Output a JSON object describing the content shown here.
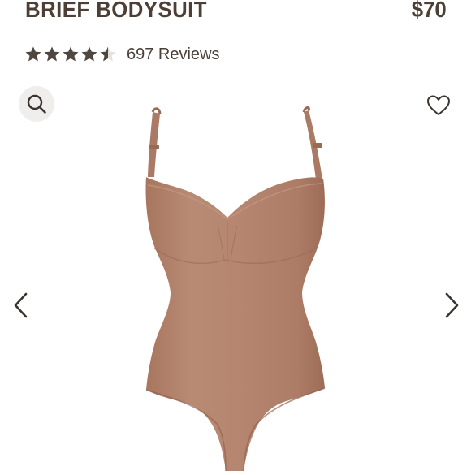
{
  "product": {
    "title": "BRIEF BODYSUIT",
    "price": "$70"
  },
  "rating": {
    "stars": 4.5,
    "max_stars": 5,
    "reviews_label": "697 Reviews"
  },
  "icons": {
    "search": "search-icon",
    "wishlist": "heart-icon",
    "prev": "chevron-left-icon",
    "next": "chevron-right-icon",
    "star": "star-icon"
  },
  "colors": {
    "text": "#4d3f35",
    "star": "#4f4640",
    "product": "#b0806a",
    "search_bg": "#f0eeec"
  }
}
